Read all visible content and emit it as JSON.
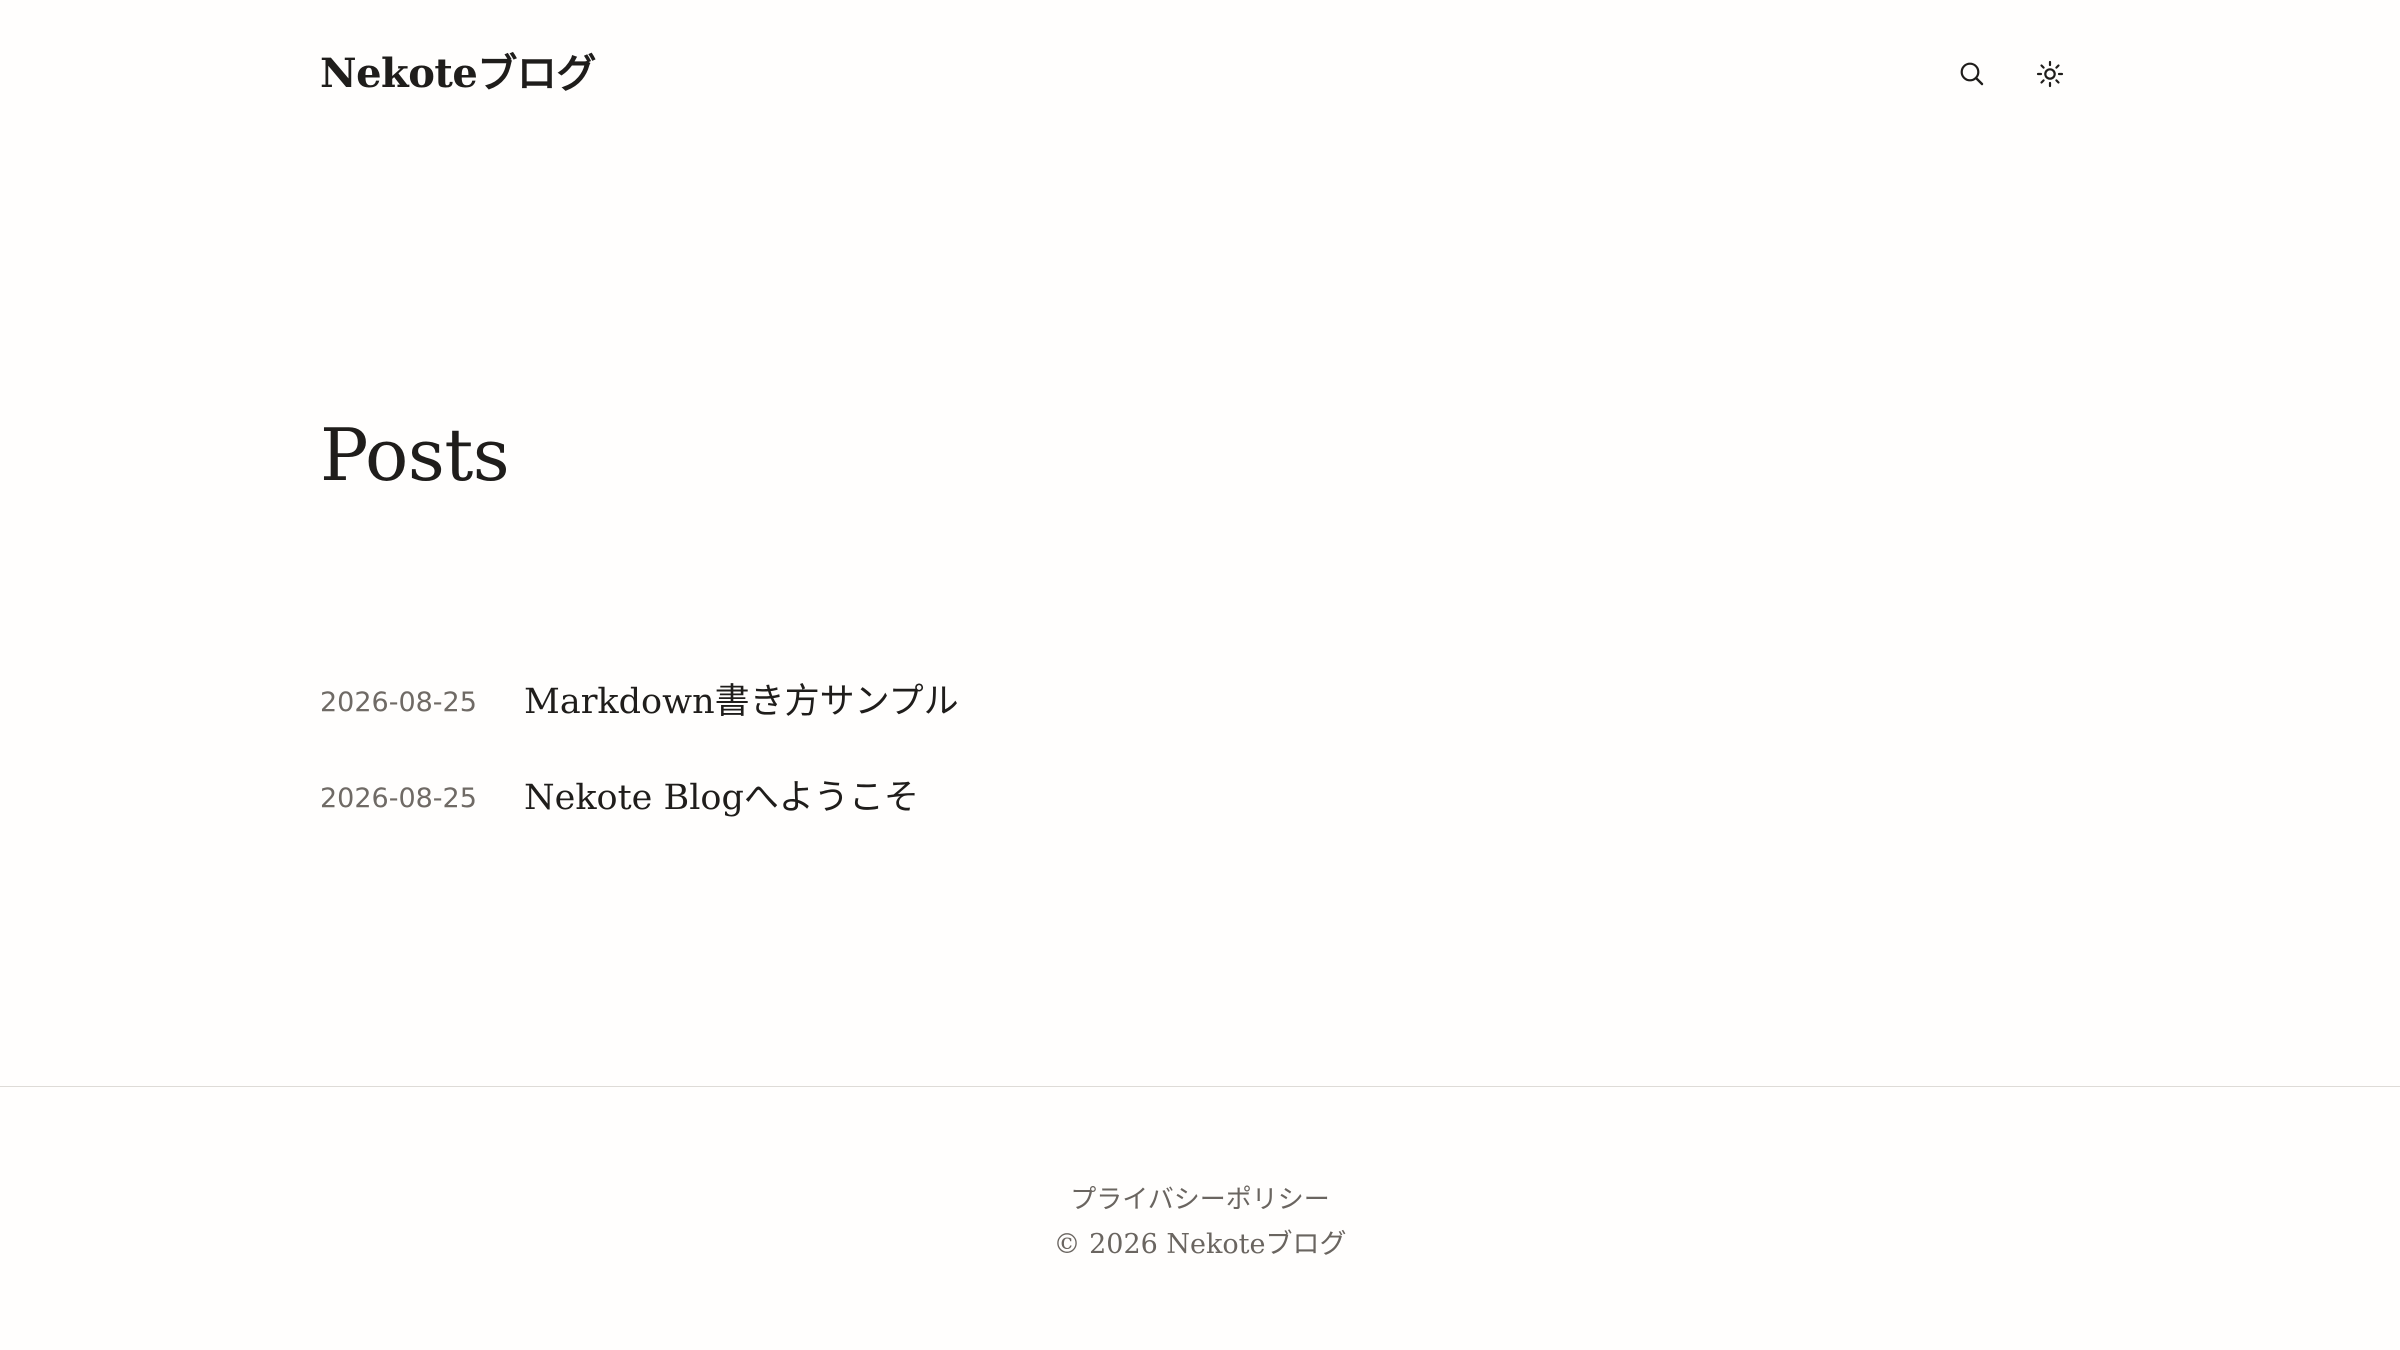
{
  "header": {
    "site_title": "Nekoteブログ",
    "search_icon": "search-icon",
    "theme_icon": "sun-icon"
  },
  "main": {
    "page_title": "Posts",
    "posts": [
      {
        "date": "2026-08-25",
        "title": "Markdown書き方サンプル"
      },
      {
        "date": "2026-08-25",
        "title": "Nekote Blogへようこそ"
      }
    ]
  },
  "footer": {
    "privacy_link": "プライバシーポリシー",
    "copyright": "© 2026 Nekoteブログ"
  },
  "colors": {
    "background": "#fffefd",
    "text": "#1f1d1b",
    "muted": "#6f6a65",
    "rule": "#dedbd7"
  }
}
